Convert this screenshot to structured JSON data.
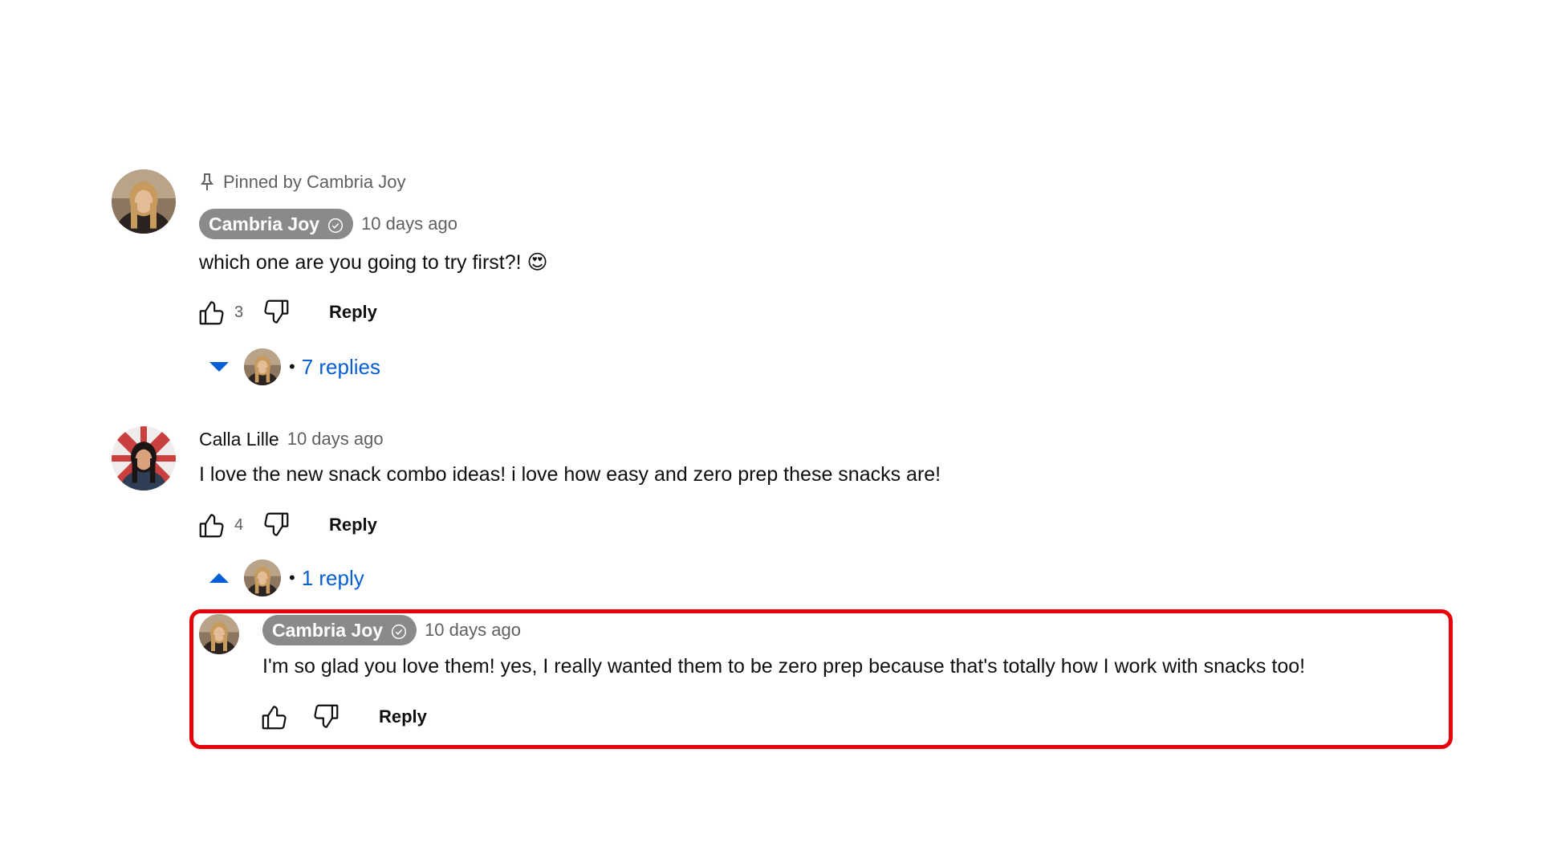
{
  "comments": [
    {
      "pinned_label": "Pinned by Cambria Joy",
      "author": "Cambria Joy",
      "author_is_creator": true,
      "time": "10 days ago",
      "text": "which one are you going to try first?! 😍",
      "likes": "3",
      "reply_label": "Reply",
      "replies_label": "7 replies",
      "replies_expanded": false,
      "avatar_icon": "avatar-cambria-joy"
    },
    {
      "author": "Calla Lille",
      "author_is_creator": false,
      "time": "10 days ago",
      "text": "I love the new snack combo ideas! i love how easy and zero prep these snacks are!",
      "likes": "4",
      "reply_label": "Reply",
      "replies_label": "1 reply",
      "replies_expanded": true,
      "avatar_icon": "avatar-calla-lille",
      "replies": [
        {
          "author": "Cambria Joy",
          "author_is_creator": true,
          "time": "10 days ago",
          "text": "I'm so glad you love them! yes, I really wanted them to be zero prep because that's totally how I work with snacks too!",
          "reply_label": "Reply",
          "avatar_icon": "avatar-cambria-joy"
        }
      ]
    }
  ],
  "colors": {
    "link_blue": "#065fd4",
    "creator_chip": "#8a8a8a",
    "highlight_red": "#e8000b",
    "meta_gray": "#606060"
  },
  "icons": [
    "pin-icon",
    "verified-icon",
    "like-icon",
    "dislike-icon",
    "chevron-down-icon",
    "chevron-up-icon"
  ]
}
